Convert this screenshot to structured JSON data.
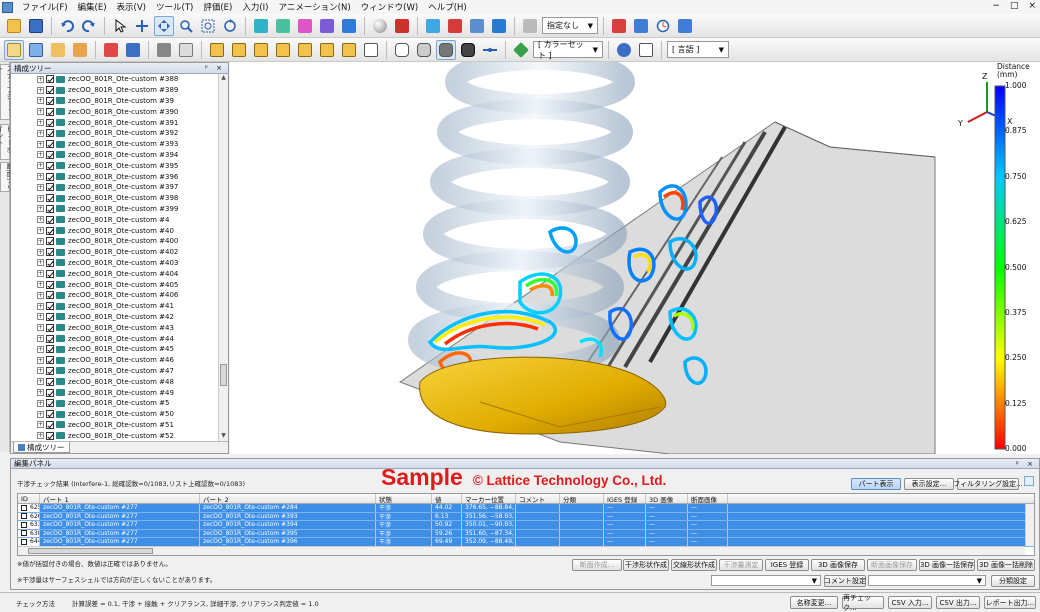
{
  "menu": [
    "ファイル(F)",
    "編集(E)",
    "表示(V)",
    "ツール(T)",
    "評価(E)",
    "入力(I)",
    "アニメーション(N)",
    "ウィンドウ(W)",
    "ヘルプ(H)"
  ],
  "window_controls": [
    "−",
    "□",
    "×"
  ],
  "toolbar1": {
    "designation_combo": "指定なし"
  },
  "toolbar2": {
    "color_set_combo": "[ カラーセット ]",
    "language_combo": "[ 言語 ]"
  },
  "vertical_tabs": [
    "スナップショット",
    "ビューポイント",
    "断面ツリー"
  ],
  "tree": {
    "title": "構成ツリー",
    "controls": "ᵖ ×",
    "tab_label": "構成ツリー",
    "items": [
      "zecOO_801R_Ote-custom #388",
      "zecOO_801R_Ote-custom #389",
      "zecOO_801R_Ote-custom #39",
      "zecOO_801R_Ote-custom #390",
      "zecOO_801R_Ote-custom #391",
      "zecOO_801R_Ote-custom #392",
      "zecOO_801R_Ote-custom #393",
      "zecOO_801R_Ote-custom #394",
      "zecOO_801R_Ote-custom #395",
      "zecOO_801R_Ote-custom #396",
      "zecOO_801R_Ote-custom #397",
      "zecOO_801R_Ote-custom #398",
      "zecOO_801R_Ote-custom #399",
      "zecOO_801R_Ote-custom #4",
      "zecOO_801R_Ote-custom #40",
      "zecOO_801R_Ote-custom #400",
      "zecOO_801R_Ote-custom #402",
      "zecOO_801R_Ote-custom #403",
      "zecOO_801R_Ote-custom #404",
      "zecOO_801R_Ote-custom #405",
      "zecOO_801R_Ote-custom #406",
      "zecOO_801R_Ote-custom #41",
      "zecOO_801R_Ote-custom #42",
      "zecOO_801R_Ote-custom #43",
      "zecOO_801R_Ote-custom #44",
      "zecOO_801R_Ote-custom #45",
      "zecOO_801R_Ote-custom #46",
      "zecOO_801R_Ote-custom #47",
      "zecOO_801R_Ote-custom #48",
      "zecOO_801R_Ote-custom #49",
      "zecOO_801R_Ote-custom #5",
      "zecOO_801R_Ote-custom #50",
      "zecOO_801R_Ote-custom #51",
      "zecOO_801R_Ote-custom #52"
    ]
  },
  "viewport": {
    "legend_title_line1": "Distance",
    "legend_title_line2": "(mm)",
    "legend_ticks": [
      "1.000",
      "0.875",
      "0.750",
      "0.625",
      "0.500",
      "0.375",
      "0.250",
      "0.125",
      "0.000"
    ],
    "axis_z": "Z",
    "axis_y": "Y",
    "axis_x": "X",
    "colors": {
      "legend_top": "#0000ff",
      "legend_mid": "#00ff00",
      "legend_high": "#ffff00",
      "legend_bottom": "#ff0000",
      "cap": "#e6b400"
    }
  },
  "edit_panel": {
    "title": "編集パネル",
    "controls": "ᵖ ×",
    "result_line": "干渉チェック結果 (Interfere-1, 総確認数=0/1083,リスト上確認数=0/1083)",
    "watermark_main": "Sample",
    "watermark_sub": "© Lattice Technology Co., Ltd.",
    "buttons_top": {
      "part_display": "パート表示",
      "display_settings": "表示設定...",
      "filtering_settings": "フィルタリング設定..."
    },
    "columns": [
      "ID",
      "パート 1",
      "パート 2",
      "状態",
      "値",
      "マーカー位置",
      "コメント",
      "分類",
      "IGES 登録",
      "3D 画像",
      "断面画像"
    ],
    "rows": [
      {
        "id": "625",
        "part1": "zecOO_801R_Ote-custom #277",
        "part2": "zecOO_801R_Ote-custom #284",
        "status": "干渉",
        "value": "44.02",
        "marker": "376.65, −88.84, 7...",
        "comment": "",
        "category": "",
        "iges": "—",
        "img3d": "—",
        "section": "—"
      },
      {
        "id": "626",
        "part1": "zecOO_801R_Ote-custom #277",
        "part2": "zecOO_801R_Ote-custom #393",
        "status": "干渉",
        "value": "6.13",
        "marker": "351.56, −58.93, 5...",
        "comment": "",
        "category": "",
        "iges": "—",
        "img3d": "—",
        "section": "—"
      },
      {
        "id": "633",
        "part1": "zecOO_801R_Ote-custom #277",
        "part2": "zecOO_801R_Ote-custom #394",
        "status": "干渉",
        "value": "50.92",
        "marker": "350.01, −90.93, 5...",
        "comment": "",
        "category": "",
        "iges": "—",
        "img3d": "—",
        "section": "—"
      },
      {
        "id": "638",
        "part1": "zecOO_801R_Ote-custom #277",
        "part2": "zecOO_801R_Ote-custom #395",
        "status": "干渉",
        "value": "59.26",
        "marker": "351.60, −87.34, 6...",
        "comment": "",
        "category": "",
        "iges": "—",
        "img3d": "—",
        "section": "—"
      },
      {
        "id": "644",
        "part1": "zecOO_801R_Ote-custom #277",
        "part2": "zecOO_801R_Ote-custom #396",
        "status": "干渉",
        "value": "69.49",
        "marker": "352.09, −88.49, 6...",
        "comment": "",
        "category": "",
        "iges": "—",
        "img3d": "—",
        "section": "—"
      }
    ],
    "note1": "※値が括弧付きの場合、数値は正確ではありません。",
    "note2": "※干渉量はサーフェスシェルでは方向が正しくないことがあります。",
    "buttons_mid": {
      "section_create": "断面作成...",
      "interf_shape_create": "干渉形状作成",
      "intersect_shape_create": "交線形状作成",
      "interf_measure": "干渉量測定",
      "iges_register": "IGES 登録",
      "save_3d_image": "3D 画像保存",
      "save_section_image": "断面画像保存",
      "save_3d_images_all": "3D 画像一括保存",
      "delete_3d_images_all": "3D 画像一括削除"
    },
    "buttons_bottom": {
      "comment_settings": "コメント設定",
      "category_settings": "分類設定"
    }
  },
  "status": {
    "check_method_label": "チェック方法",
    "check_method_value": "計算誤差 = 0.1, 干渉 + 接触 + クリアランス, 詳細干渉, クリアランス判定値 = 1.0",
    "buttons": [
      "名称変更...",
      "再チェック...",
      "CSV 入力...",
      "CSV 出力...",
      "レポート出力..."
    ]
  }
}
